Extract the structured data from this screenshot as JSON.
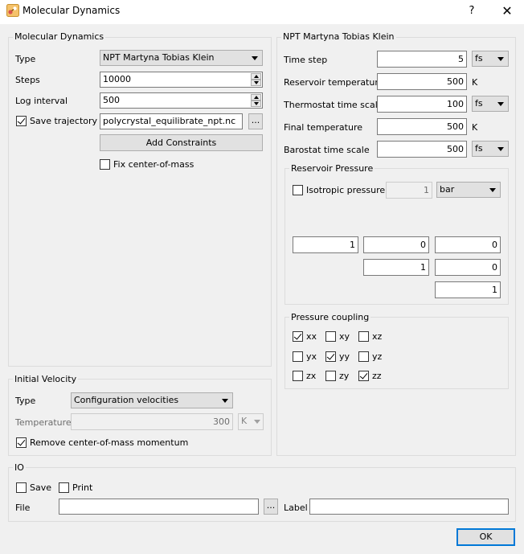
{
  "window": {
    "title": "Molecular Dynamics",
    "help": "?",
    "close": "✕"
  },
  "md": {
    "group_title": "Molecular Dynamics",
    "type_label": "Type",
    "type_value": "NPT Martyna Tobias Klein",
    "steps_label": "Steps",
    "steps_value": "10000",
    "log_label": "Log interval",
    "log_value": "500",
    "save_traj_label": "Save trajectory",
    "save_traj_checked": true,
    "traj_file": "polycrystal_equilibrate_npt.nc",
    "browse": "...",
    "add_constraints": "Add Constraints",
    "fix_com_label": "Fix center-of-mass",
    "fix_com_checked": false
  },
  "velocity": {
    "group_title": "Initial Velocity",
    "type_label": "Type",
    "type_value": "Configuration velocities",
    "temp_label": "Temperature",
    "temp_value": "300",
    "temp_unit": "K",
    "remove_com_label": "Remove center-of-mass momentum",
    "remove_com_checked": true
  },
  "npt": {
    "group_title": "NPT Martyna Tobias Klein",
    "time_step_label": "Time step",
    "time_step_value": "5",
    "time_step_unit": "fs",
    "res_temp_label": "Reservoir temperature",
    "res_temp_value": "500",
    "res_temp_unit": "K",
    "thermo_label": "Thermostat time scale",
    "thermo_value": "100",
    "thermo_unit": "fs",
    "final_temp_label": "Final temperature",
    "final_temp_value": "500",
    "final_temp_unit": "K",
    "baro_label": "Barostat time scale",
    "baro_value": "500",
    "baro_unit": "fs"
  },
  "pressure": {
    "group_title": "Reservoir Pressure",
    "isotropic_label": "Isotropic pressure",
    "isotropic_checked": false,
    "isotropic_value": "1",
    "unit": "bar",
    "matrix": {
      "xx": "1",
      "xy": "0",
      "xz": "0",
      "yy": "1",
      "yz": "0",
      "zz": "1"
    }
  },
  "coupling": {
    "group_title": "Pressure coupling",
    "items": [
      {
        "label": "xx",
        "checked": true
      },
      {
        "label": "xy",
        "checked": false
      },
      {
        "label": "xz",
        "checked": false
      },
      {
        "label": "yx",
        "checked": false
      },
      {
        "label": "yy",
        "checked": true
      },
      {
        "label": "yz",
        "checked": false
      },
      {
        "label": "zx",
        "checked": false
      },
      {
        "label": "zy",
        "checked": false
      },
      {
        "label": "zz",
        "checked": true
      }
    ]
  },
  "io": {
    "group_title": "IO",
    "save_label": "Save",
    "save_checked": false,
    "print_label": "Print",
    "print_checked": false,
    "file_label": "File",
    "file_value": "",
    "browse": "...",
    "label_label": "Label",
    "label_value": ""
  },
  "ok": "OK"
}
